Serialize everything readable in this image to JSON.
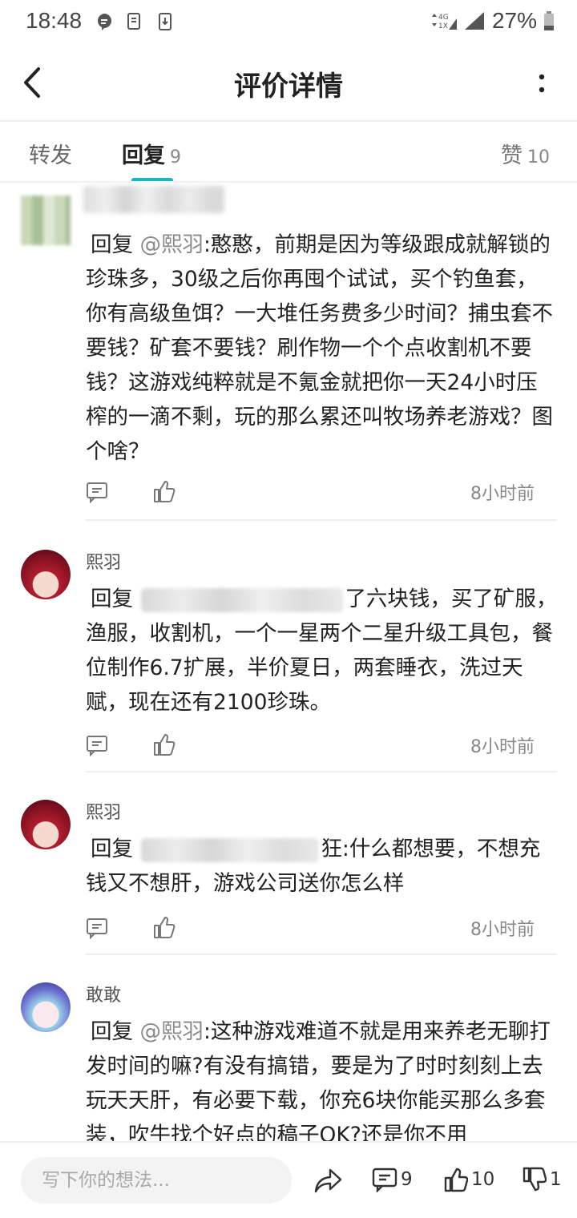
{
  "status_bar": {
    "time": "18:48",
    "network": "4G",
    "battery": "27%"
  },
  "header": {
    "title": "评价详情"
  },
  "tabs": {
    "repost": {
      "label": "转发"
    },
    "reply": {
      "label": "回复",
      "count": "9"
    },
    "like": {
      "label": "赞",
      "count": "10"
    }
  },
  "replies": [
    {
      "username": "",
      "prefix": "回复",
      "mention": "@熙羽",
      "text": ":憨憨，前期是因为等级跟成就解锁的珍珠多，30级之后你再囤个试试，买个钓鱼套，你有高级鱼饵？一大堆任务费多少时间？捕虫套不要钱？矿套不要钱？刷作物一个个点收割机不要钱？这游戏纯粹就是不氪金就把你一天24小时压榨的一滴不剩，玩的那么累还叫牧场养老游戏？图个啥？",
      "time": "8小时前"
    },
    {
      "username": "熙羽",
      "prefix": "回复",
      "mention": "",
      "text": "了六块钱，买了矿服，渔服，收割机，一个一星两个二星升级工具包，餐位制作6.7扩展，半价夏日，两套睡衣，洗过天赋，现在还有2100珍珠。",
      "time": "8小时前"
    },
    {
      "username": "熙羽",
      "prefix": "回复",
      "mention": "",
      "text": "狂:什么都想要，不想充钱又不想肝，游戏公司送你怎么样",
      "time": "8小时前"
    },
    {
      "username": "敢敢",
      "prefix": "回复",
      "mention": "@熙羽",
      "text": ":这种游戏难道不就是用来养老无聊打发时间的嘛?有没有搞错，要是为了时时刻刻上去玩天天肝，有必要下载，你充6块你能买那么多套装，吹牛找个好点的稿子OK?还是你不用",
      "time": ""
    }
  ],
  "bottom_bar": {
    "input_placeholder": "写下你的想法...",
    "reply_count": "9",
    "like_count": "10",
    "dislike_count": "1"
  },
  "colors": {
    "accent": "#18b6c4",
    "text_primary": "#222222",
    "text_secondary": "#888888"
  },
  "icons": [
    "back-icon",
    "more-icon",
    "comment-icon",
    "thumbs-up-icon",
    "share-icon",
    "thumbs-down-icon"
  ]
}
